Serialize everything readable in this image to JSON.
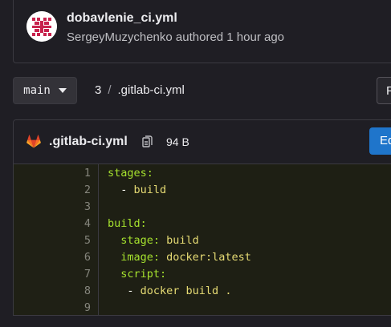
{
  "commit": {
    "title": "dobavlenie_ci.yml",
    "author": "SergeyMuzychenko",
    "action": "authored",
    "time": "1 hour ago"
  },
  "toolbar": {
    "branch": "main",
    "breadcrumb": [
      "3",
      ".gitlab-ci.yml"
    ],
    "right_button_label": "F"
  },
  "file": {
    "name": ".gitlab-ci.yml",
    "size": "94 B",
    "edit_label": "Ed",
    "icons": {
      "file_type": "gitlab-icon",
      "copy": "copy-icon"
    }
  },
  "code_lines": [
    {
      "n": "1",
      "key": "stages",
      "sep": ":",
      "val": "",
      "indent": ""
    },
    {
      "n": "2",
      "key": "",
      "sep": "- ",
      "val": "build",
      "indent": "  "
    },
    {
      "n": "3",
      "key": "",
      "sep": "",
      "val": "",
      "indent": ""
    },
    {
      "n": "4",
      "key": "build",
      "sep": ":",
      "val": "",
      "indent": ""
    },
    {
      "n": "5",
      "key": "stage",
      "sep": ": ",
      "val": "build",
      "indent": "  "
    },
    {
      "n": "6",
      "key": "image",
      "sep": ": ",
      "val": "docker:latest",
      "indent": "  "
    },
    {
      "n": "7",
      "key": "script",
      "sep": ":",
      "val": "",
      "indent": "  "
    },
    {
      "n": "8",
      "key": "",
      "sep": "- ",
      "val": "docker build .",
      "indent": "   "
    },
    {
      "n": "9",
      "key": "",
      "sep": "",
      "val": "",
      "indent": ""
    }
  ]
}
